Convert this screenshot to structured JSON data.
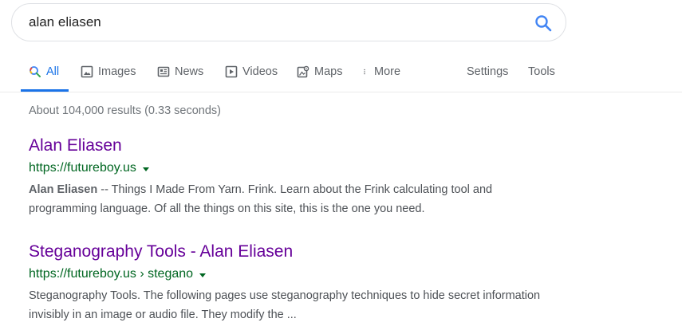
{
  "search": {
    "query": "alan eliasen"
  },
  "tabs": {
    "all": "All",
    "images": "Images",
    "news": "News",
    "videos": "Videos",
    "maps": "Maps",
    "more": "More",
    "settings": "Settings",
    "tools": "Tools"
  },
  "colors": {
    "accent": "#1a73e8",
    "visited_link": "#660099",
    "url_green": "#006621",
    "muted": "#70757a"
  },
  "result_stats": "About 104,000 results (0.33 seconds)",
  "results": [
    {
      "title": "Alan Eliasen",
      "url": "https://futureboy.us",
      "snippet_bold": "Alan Eliasen",
      "snippet_line1_rest": " -- Things I Made From Yarn. Frink. Learn about the Frink calculating tool and",
      "snippet_line2": "programming language. Of all the things on this site, this is the one you need."
    },
    {
      "title": "Steganography Tools - Alan Eliasen",
      "url": "https://futureboy.us › stegano",
      "snippet_line1": "Steganography Tools. The following pages use steganography techniques to hide secret information",
      "snippet_line2": "invisibly in an image or audio file. They modify the ..."
    }
  ]
}
